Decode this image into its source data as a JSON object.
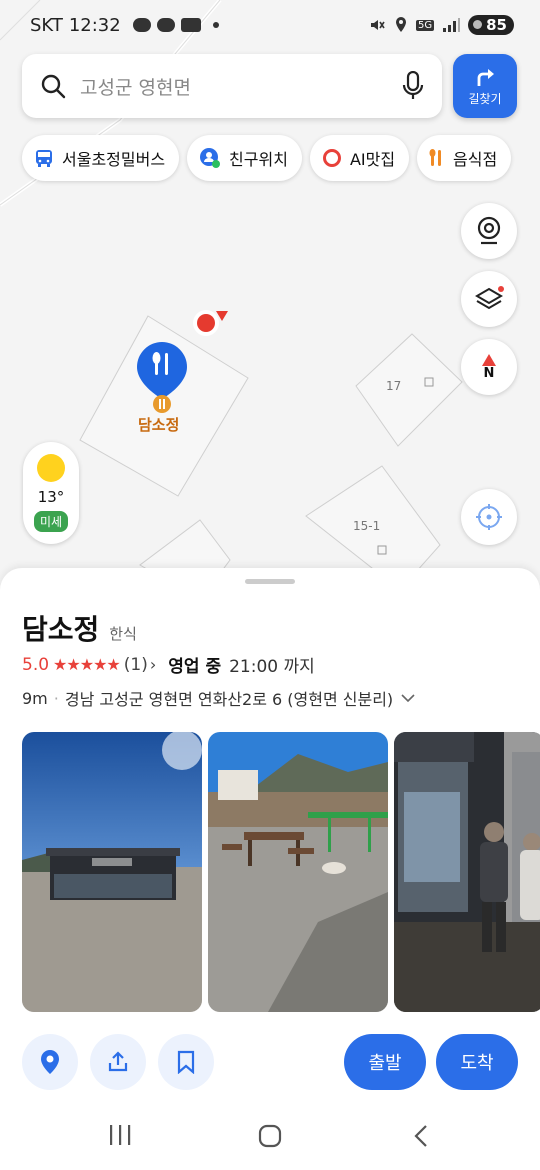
{
  "status_bar": {
    "carrier": "SKT",
    "time": "12:32",
    "network": "5G",
    "battery": "85"
  },
  "search": {
    "query": "고성군 영현면"
  },
  "directions_button": {
    "label": "길찾기"
  },
  "chips": [
    {
      "label": "서울초정밀버스",
      "icon": "bus-icon"
    },
    {
      "label": "친구위치",
      "icon": "friend-location-icon"
    },
    {
      "label": "AI맛집",
      "icon": "ai-ring-icon"
    },
    {
      "label": "음식점",
      "icon": "restaurant-icon"
    }
  ],
  "map": {
    "place_label": "담소정",
    "lot_numbers": [
      "17",
      "15-1"
    ],
    "compass_label": "N"
  },
  "weather": {
    "temperature": "13°",
    "dust_label": "미세"
  },
  "place": {
    "name": "담소정",
    "category": "한식",
    "rating": "5.0",
    "stars": "★★★★★",
    "review_count": "(1)",
    "status": "영업 중",
    "hours": "21:00 까지",
    "distance": "9m",
    "address": "경남 고성군 영현면 연화산2로 6 (영현면 신분리)"
  },
  "actions": {
    "depart_label": "출발",
    "arrive_label": "도착"
  },
  "colors": {
    "accent": "#2b6ee8",
    "rating_red": "#e8413a",
    "place_orange": "#c86a10",
    "dust_green": "#3ba34f"
  }
}
